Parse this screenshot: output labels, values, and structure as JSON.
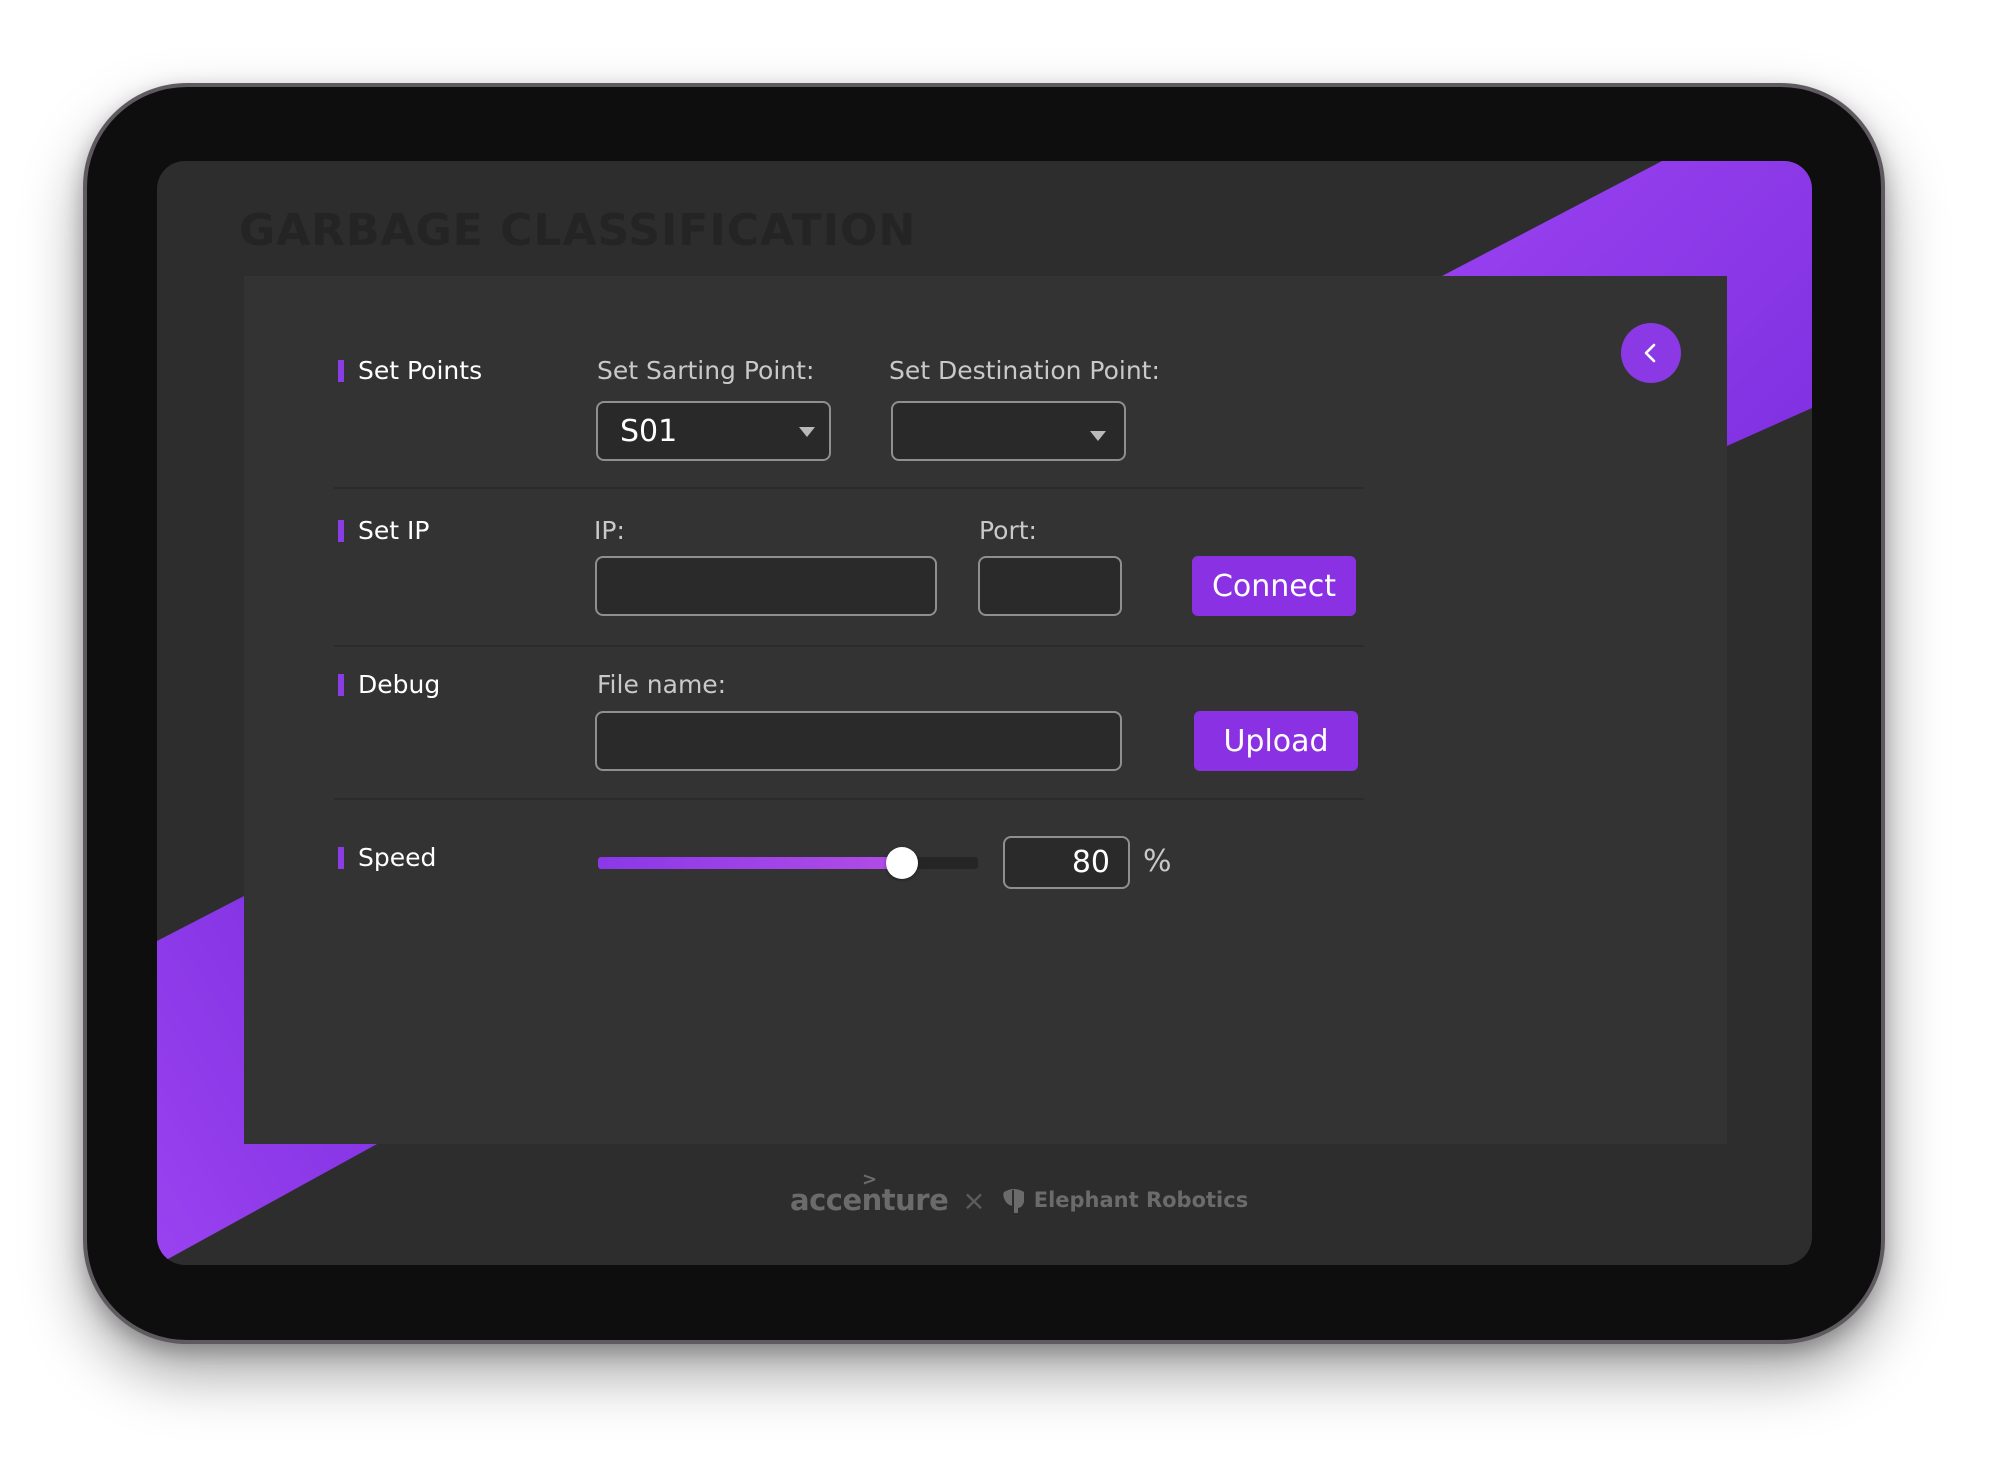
{
  "screen": {
    "title": "GARBAGE CLASSIFICATION"
  },
  "colors": {
    "accent": "#8a39e4",
    "screen_bg": "#2d2d2e",
    "panel_bg": "#333334"
  },
  "back_button": {
    "icon": "chevron-left-icon"
  },
  "set_points": {
    "label": "Set Points",
    "start_label": "Set Sarting Point:",
    "start_value": "S01",
    "destination_label": "Set Destination Point:",
    "destination_value": ""
  },
  "set_ip": {
    "label": "Set IP",
    "ip_label": "IP:",
    "ip_value": "",
    "port_label": "Port:",
    "port_value": "",
    "connect_label": "Connect"
  },
  "debug": {
    "label": "Debug",
    "file_label": "File name:",
    "file_value": "",
    "upload_label": "Upload"
  },
  "speed": {
    "label": "Speed",
    "value": "80",
    "unit": "%",
    "percent": 80
  },
  "footer": {
    "brand_left": "accenture",
    "separator": "×",
    "brand_right": "Elephant Robotics"
  }
}
